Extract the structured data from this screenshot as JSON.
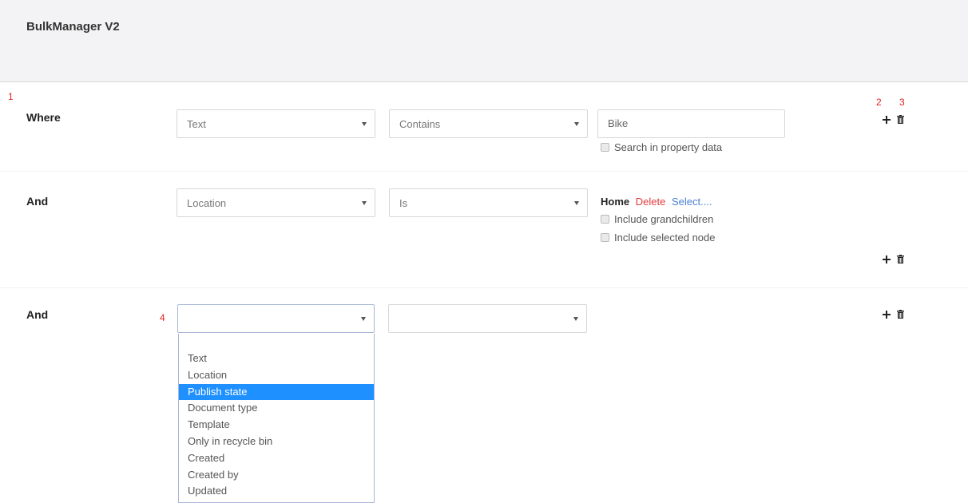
{
  "app": {
    "title": "BulkManager V2"
  },
  "markers": {
    "m1": "1",
    "m2": "2",
    "m3": "3",
    "m4": "4"
  },
  "rows": [
    {
      "label": "Where",
      "field": "Text",
      "operator": "Contains",
      "value": "Bike",
      "checkbox": "Search in property data"
    },
    {
      "label": "And",
      "field": "Location",
      "operator": "Is",
      "node": {
        "name": "Home",
        "delete": "Delete",
        "select": "Select...."
      },
      "checkboxes": [
        "Include grandchildren",
        "Include selected node"
      ]
    },
    {
      "label": "And",
      "field": "",
      "operator": ""
    }
  ],
  "dropdown": {
    "options": [
      "",
      "Text",
      "Location",
      "Publish state",
      "Document type",
      "Template",
      "Only in recycle bin",
      "Created",
      "Created by",
      "Updated"
    ],
    "highlighted": "Publish state"
  },
  "icons": {
    "add": "plus-icon",
    "delete": "trash-icon"
  },
  "colors": {
    "highlight": "#1e90ff",
    "delete_link": "#e03a3a",
    "select_link": "#4a7fd6",
    "marker": "#e02020"
  }
}
